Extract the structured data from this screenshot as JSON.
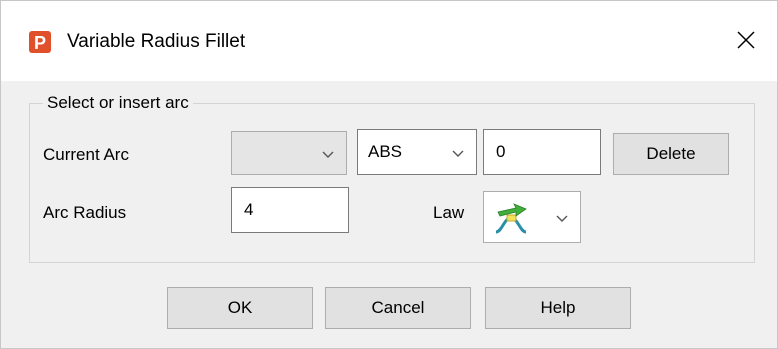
{
  "window": {
    "title": "Variable Radius Fillet",
    "app_icon": "p-logo-icon",
    "close_glyph": "✕",
    "accent_color": "#e0502a"
  },
  "group": {
    "title": "Select or insert arc"
  },
  "current_arc": {
    "label": "Current Arc",
    "arc_select_value": "",
    "mode_select_value": "ABS",
    "value_input": "0",
    "delete_label": "Delete"
  },
  "arc_radius": {
    "label": "Arc Radius",
    "value": "4"
  },
  "law": {
    "label": "Law",
    "icon": "law-curve-icon"
  },
  "buttons": {
    "ok": "OK",
    "cancel": "Cancel",
    "help": "Help"
  }
}
